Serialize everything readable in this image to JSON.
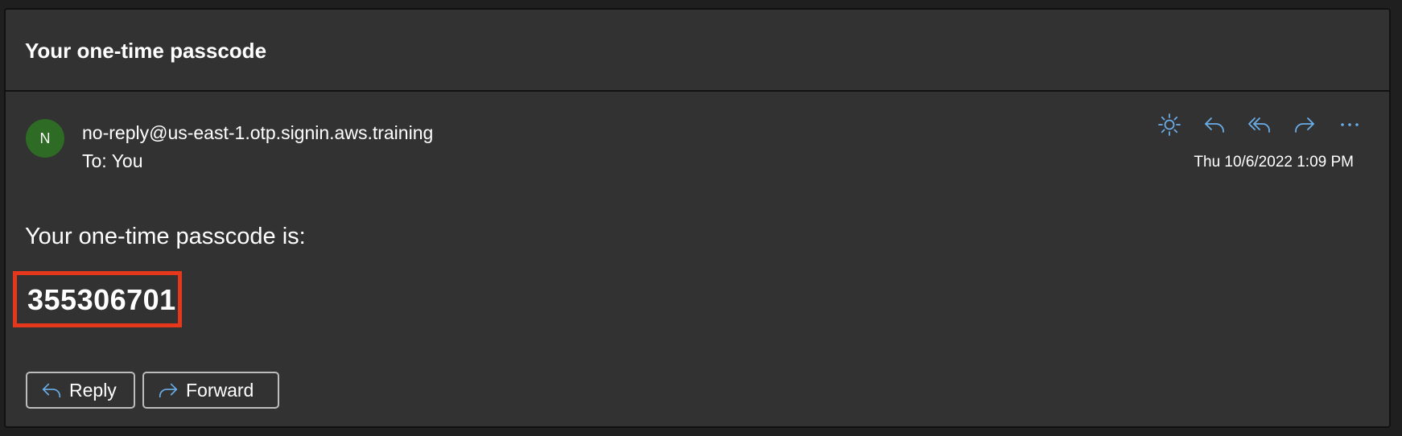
{
  "email": {
    "subject": "Your one-time passcode",
    "sender_initial": "N",
    "sender": "no-reply@us-east-1.otp.signin.aws.training",
    "to_label": "To:",
    "to_name": "You",
    "timestamp": "Thu 10/6/2022 1:09 PM",
    "body_text": "Your one-time passcode is:",
    "passcode": "355306701"
  },
  "toolbar": {
    "icons": [
      "brightness-icon",
      "reply-icon",
      "reply-all-icon",
      "forward-icon",
      "more-icon"
    ]
  },
  "footer": {
    "reply_label": "Reply",
    "forward_label": "Forward"
  },
  "colors": {
    "background": "#323232",
    "accent_icon": "#6aaee8",
    "avatar": "#2e6b24",
    "highlight_border": "#e5371c"
  }
}
